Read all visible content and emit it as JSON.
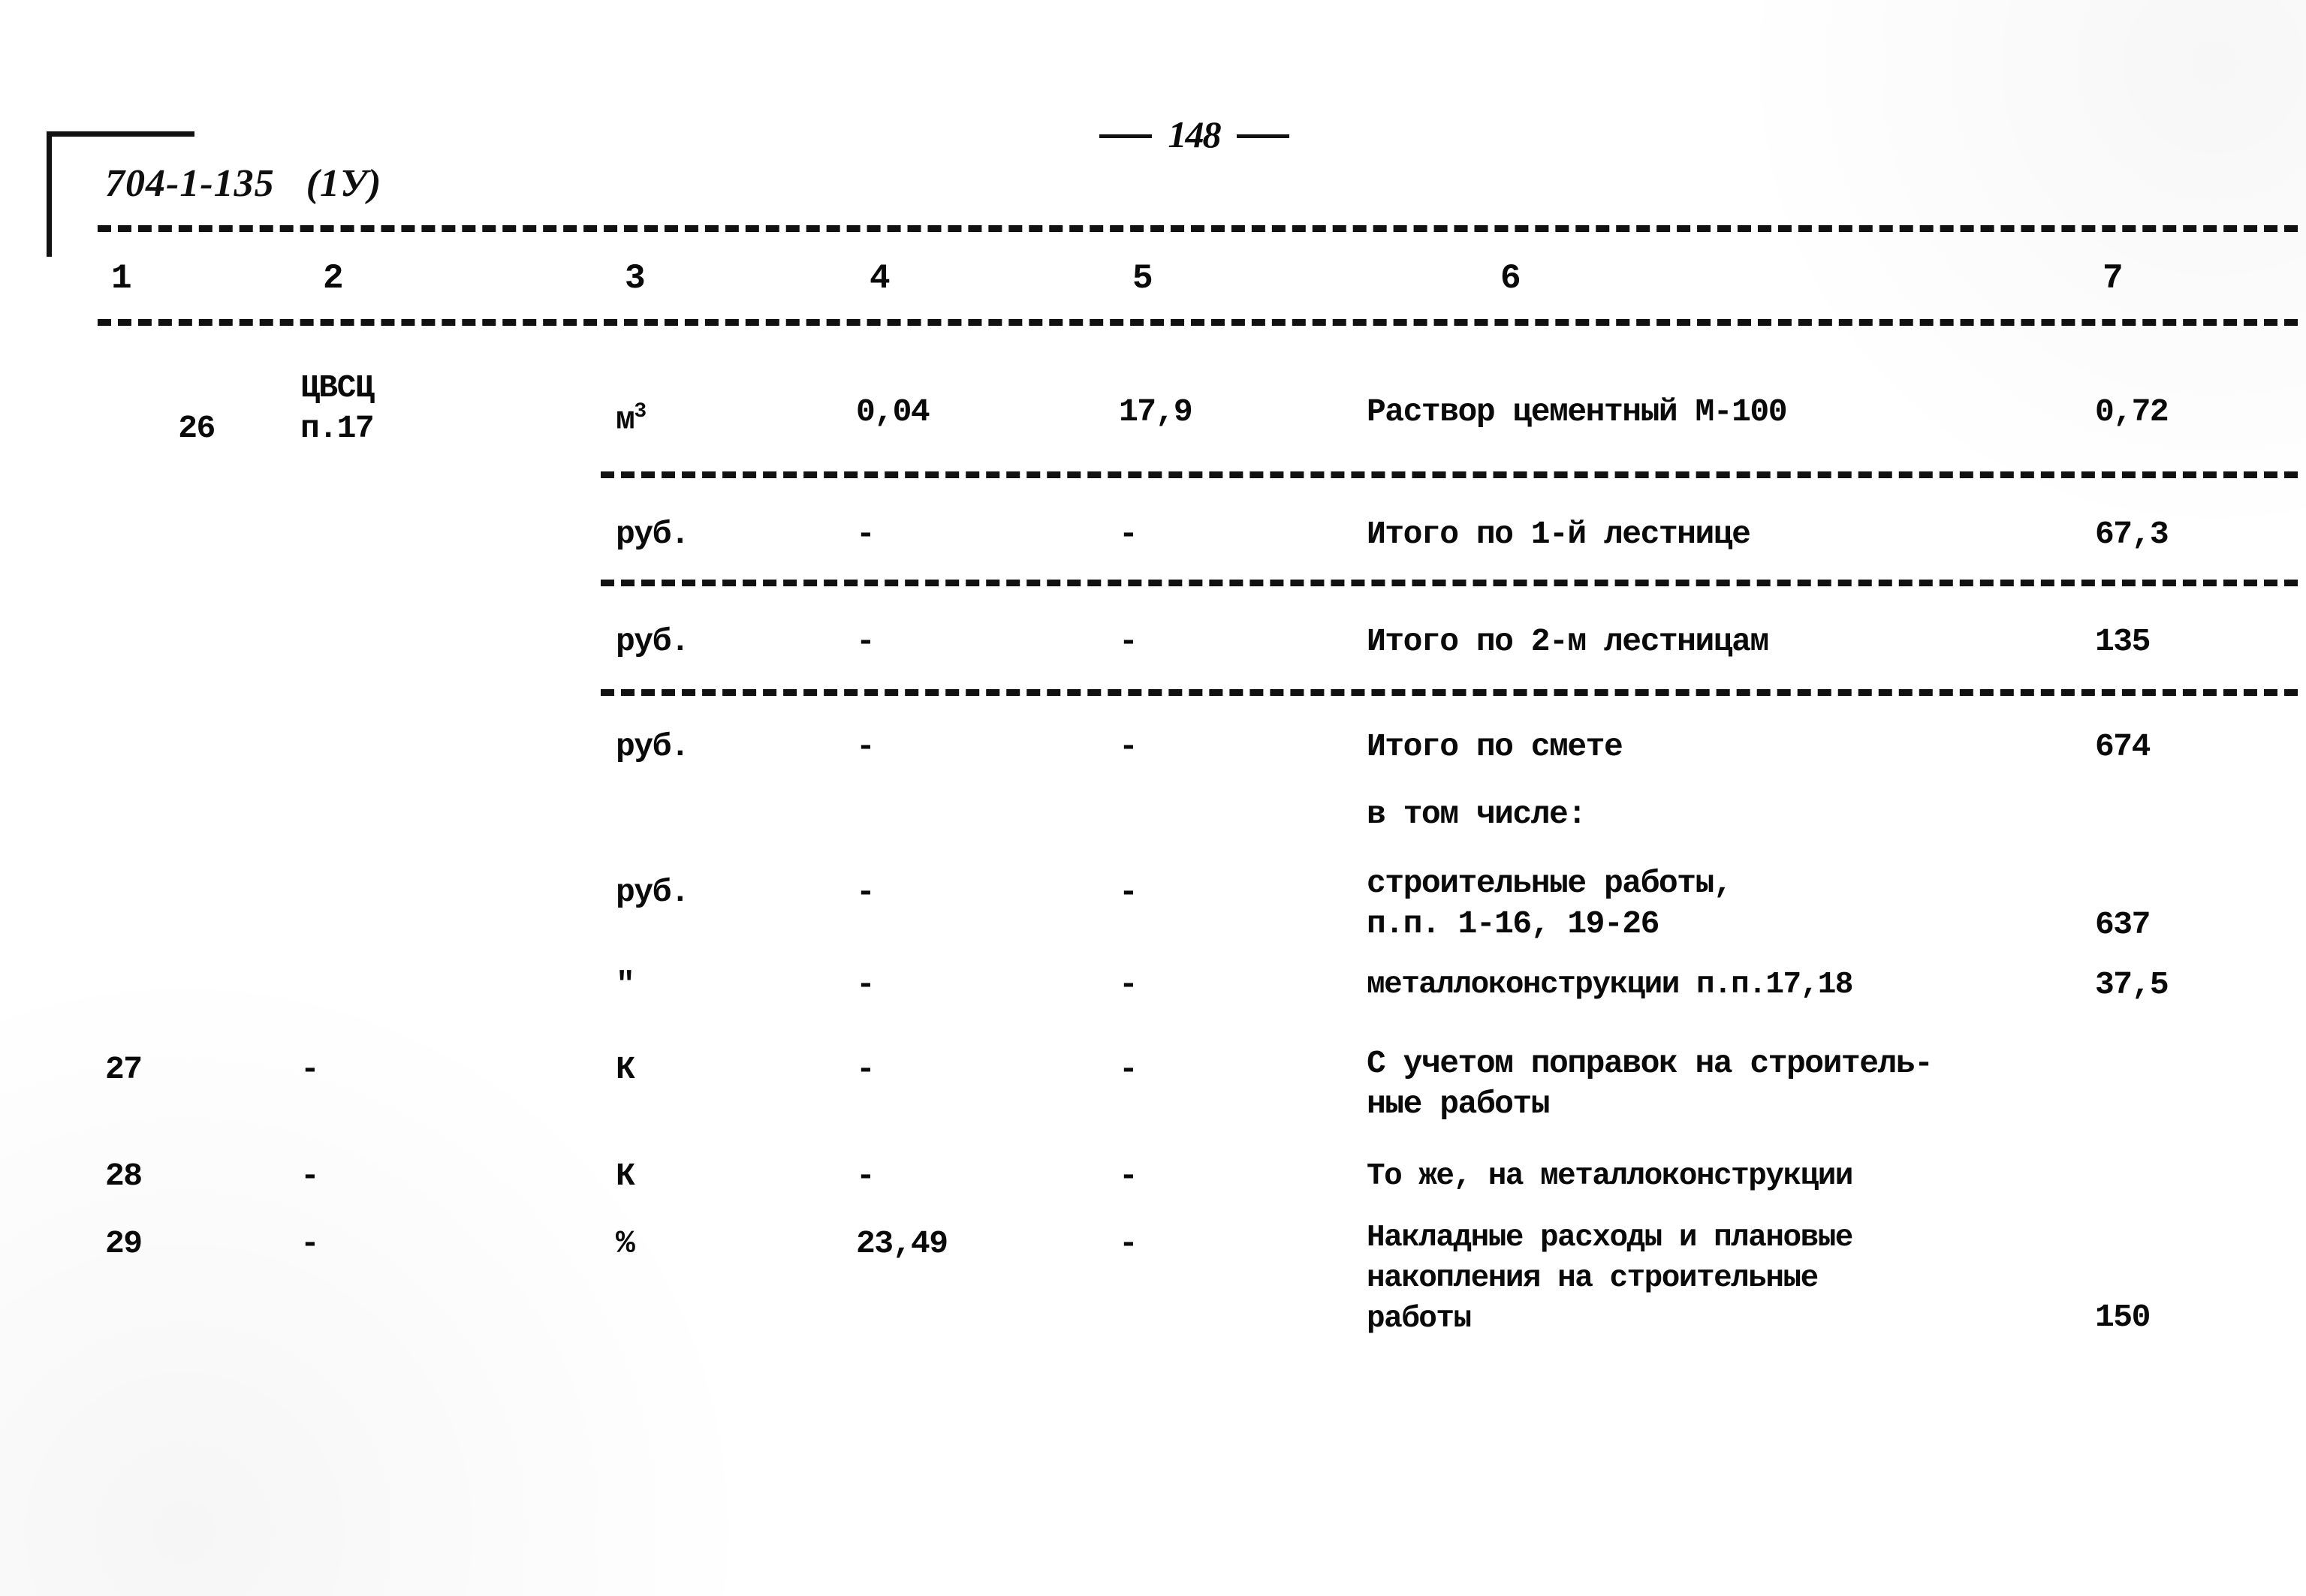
{
  "document": {
    "page_number": "148",
    "sheet_code": "704-1-135",
    "sheet_variant": "(1У)"
  },
  "table": {
    "column_headers": [
      "1",
      "2",
      "3",
      "4",
      "5",
      "6",
      "7"
    ],
    "rows": [
      {
        "no": "26",
        "justification": "ЦВСЦ\nп.17",
        "unit": "м",
        "unit_sup": "3",
        "quantity": "0,04",
        "unit_price": "17,9",
        "description": "Раствор цементный М-100",
        "total": "0,72"
      },
      {
        "no": "",
        "justification": "",
        "unit": "руб.",
        "unit_sup": "",
        "quantity": "-",
        "unit_price": "-",
        "description": "Итого по 1-й лестнице",
        "total": "67,3"
      },
      {
        "no": "",
        "justification": "",
        "unit": "руб.",
        "unit_sup": "",
        "quantity": "-",
        "unit_price": "-",
        "description": "Итого по 2-м лестницам",
        "total": "135"
      },
      {
        "no": "",
        "justification": "",
        "unit": "руб.",
        "unit_sup": "",
        "quantity": "-",
        "unit_price": "-",
        "description": "Итого по смете",
        "total": "674"
      },
      {
        "no": "",
        "justification": "",
        "unit": "",
        "unit_sup": "",
        "quantity": "",
        "unit_price": "",
        "description": "в том числе:",
        "total": ""
      },
      {
        "no": "",
        "justification": "",
        "unit": "руб.",
        "unit_sup": "",
        "quantity": "-",
        "unit_price": "-",
        "description": "строительные работы,\nп.п. 1-16, 19-26",
        "total": "637"
      },
      {
        "no": "",
        "justification": "",
        "unit": "\"",
        "unit_sup": "",
        "quantity": "-",
        "unit_price": "-",
        "description": "металлоконструкции п.п.17,18",
        "total": "37,5"
      },
      {
        "no": "27",
        "justification": "-",
        "unit": "К",
        "unit_sup": "",
        "quantity": "-",
        "unit_price": "-",
        "description": "С учетом поправок на строитель-\nные работы",
        "total": ""
      },
      {
        "no": "28",
        "justification": "-",
        "unit": "К",
        "unit_sup": "",
        "quantity": "-",
        "unit_price": "-",
        "description": "То же, на металлоконструкции",
        "total": ""
      },
      {
        "no": "29",
        "justification": "-",
        "unit": "%",
        "unit_sup": "",
        "quantity": "23,49",
        "unit_price": "-",
        "description": "Накладные расходы и плановые\nнакопления на строительные\nработы",
        "total": "150"
      }
    ]
  }
}
